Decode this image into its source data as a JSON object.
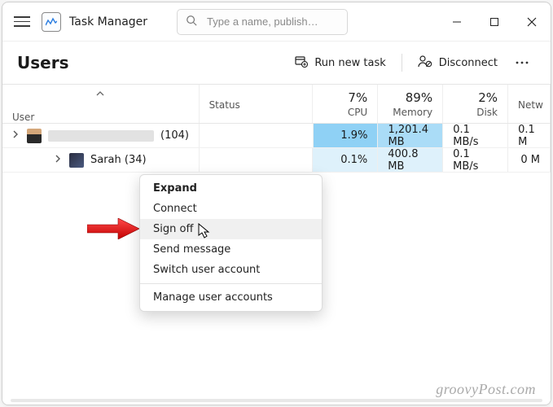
{
  "app": {
    "title": "Task Manager",
    "search_placeholder": "Type a name, publish…"
  },
  "page": {
    "heading": "Users"
  },
  "toolbar": {
    "run_new_task": "Run new task",
    "disconnect": "Disconnect"
  },
  "columns": {
    "user": "User",
    "status": "Status",
    "cpu": {
      "pct": "7%",
      "label": "CPU"
    },
    "memory": {
      "pct": "89%",
      "label": "Memory"
    },
    "disk": {
      "pct": "2%",
      "label": "Disk"
    },
    "network": {
      "label": "Netw"
    }
  },
  "rows": [
    {
      "name_hidden": true,
      "suffix": "(104)",
      "status": "",
      "cpu": "1.9%",
      "memory": "1,201.4 MB",
      "disk": "0.1 MB/s",
      "network": "0.1 M"
    },
    {
      "name": "Sarah (34)",
      "status": "",
      "cpu": "0.1%",
      "memory": "400.8 MB",
      "disk": "0.1 MB/s",
      "network": "0 M"
    }
  ],
  "context_menu": {
    "expand": "Expand",
    "connect": "Connect",
    "sign_off": "Sign off",
    "send_message": "Send message",
    "switch_user": "Switch user account",
    "manage": "Manage user accounts"
  },
  "watermark": "groovyPost.com"
}
